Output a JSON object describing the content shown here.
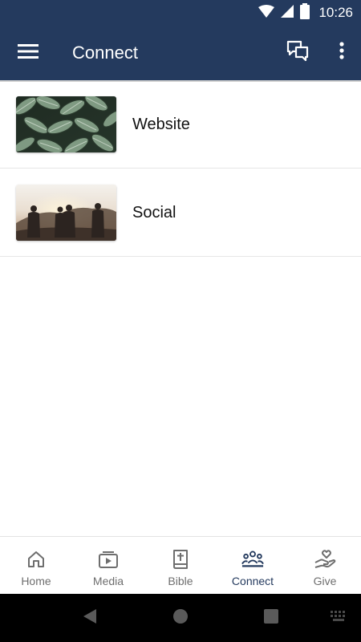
{
  "status_bar": {
    "time": "10:26",
    "icons": [
      "wifi-icon",
      "cell-signal-icon",
      "battery-icon"
    ]
  },
  "app_bar": {
    "title": "Connect",
    "icons": [
      "menu-icon",
      "chat-icon",
      "more-vert-icon"
    ]
  },
  "items": [
    {
      "label": "Website",
      "thumbnail": "leaves-photo"
    },
    {
      "label": "Social",
      "thumbnail": "people-sunset-photo"
    }
  ],
  "bottom_nav": {
    "active": "Connect",
    "tabs": [
      {
        "label": "Home",
        "icon": "home-icon"
      },
      {
        "label": "Media",
        "icon": "media-icon"
      },
      {
        "label": "Bible",
        "icon": "bible-icon"
      },
      {
        "label": "Connect",
        "icon": "connect-icon"
      },
      {
        "label": "Give",
        "icon": "give-icon"
      }
    ]
  },
  "colors": {
    "primary": "#243a5e",
    "inactive": "#6e6e6e",
    "divider": "#e6e6e6"
  }
}
